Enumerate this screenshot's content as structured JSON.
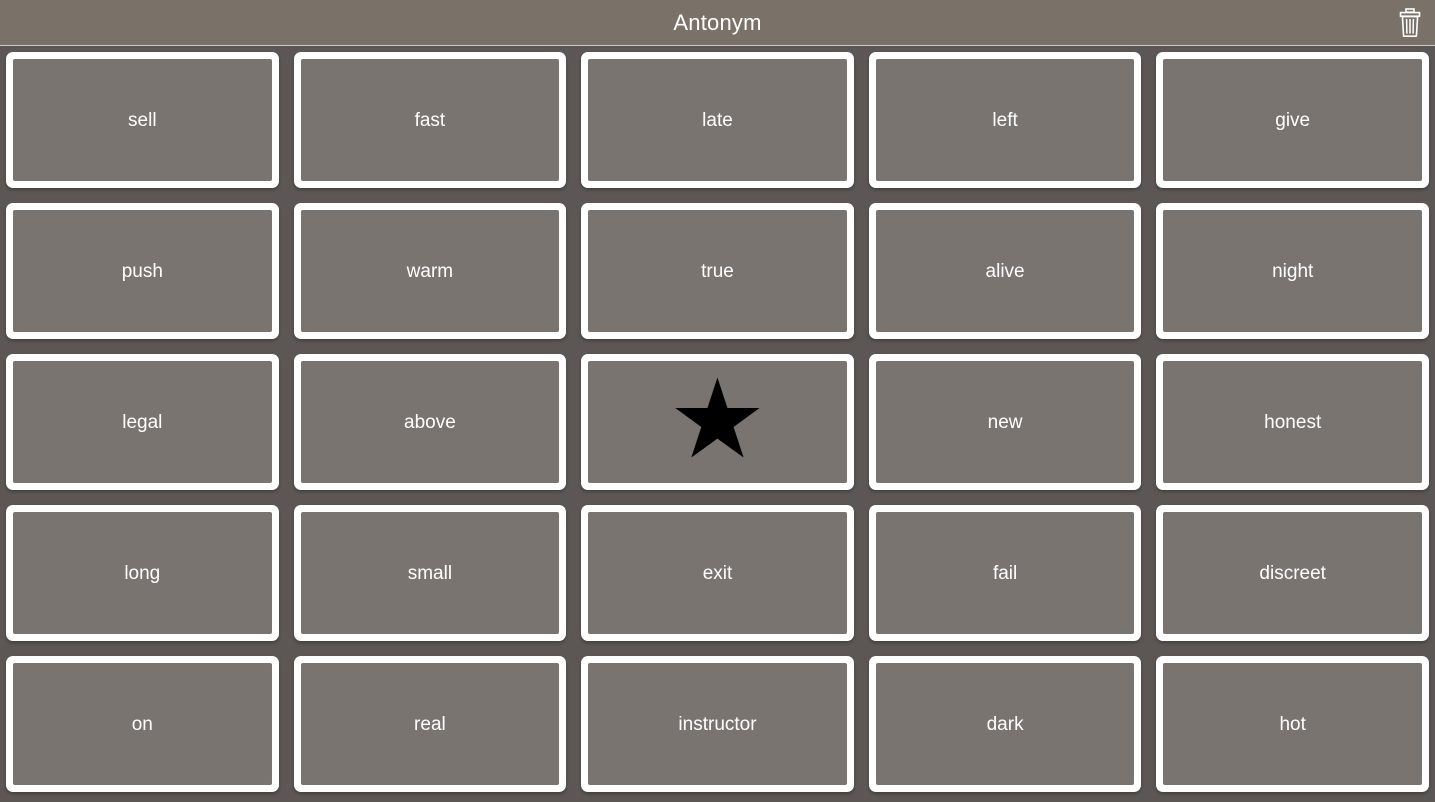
{
  "header": {
    "title": "Antonym",
    "trash_icon": "trash-icon",
    "background_color": "#7a7168",
    "title_color": "#ffffff"
  },
  "board": {
    "background_color": "#5c5754",
    "card_face_color": "#7a7470",
    "card_border_color": "#ffffff",
    "columns": 5,
    "rows": 5,
    "cards": [
      {
        "label": "sell",
        "type": "word"
      },
      {
        "label": "fast",
        "type": "word"
      },
      {
        "label": "late",
        "type": "word"
      },
      {
        "label": "left",
        "type": "word"
      },
      {
        "label": "give",
        "type": "word"
      },
      {
        "label": "push",
        "type": "word"
      },
      {
        "label": "warm",
        "type": "word"
      },
      {
        "label": "true",
        "type": "word"
      },
      {
        "label": "alive",
        "type": "word"
      },
      {
        "label": "night",
        "type": "word"
      },
      {
        "label": "legal",
        "type": "word"
      },
      {
        "label": "above",
        "type": "word"
      },
      {
        "label": "★",
        "type": "star",
        "icon": "star-icon"
      },
      {
        "label": "new",
        "type": "word"
      },
      {
        "label": "honest",
        "type": "word"
      },
      {
        "label": "long",
        "type": "word"
      },
      {
        "label": "small",
        "type": "word"
      },
      {
        "label": "exit",
        "type": "word"
      },
      {
        "label": "fail",
        "type": "word"
      },
      {
        "label": "discreet",
        "type": "word"
      },
      {
        "label": "on",
        "type": "word"
      },
      {
        "label": "real",
        "type": "word"
      },
      {
        "label": "instructor",
        "type": "word"
      },
      {
        "label": "dark",
        "type": "word"
      },
      {
        "label": "hot",
        "type": "word"
      }
    ]
  }
}
